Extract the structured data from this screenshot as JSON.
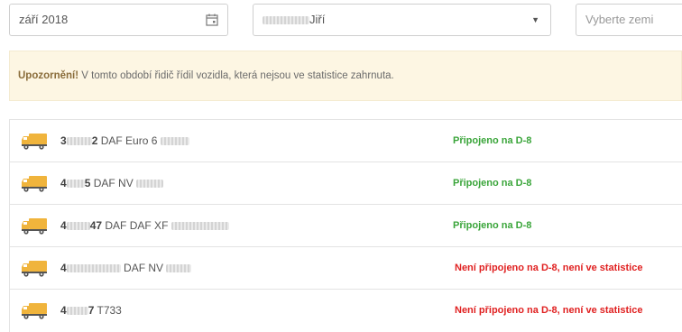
{
  "filters": {
    "month_value": "září 2018",
    "driver_value": "Jiří",
    "country_placeholder": "Vyberte zemi"
  },
  "warning": {
    "title": "Upozornění!",
    "message": "V tomto období řidič řídil vozidla, která nejsou ve statistice zahrnuta."
  },
  "vehicles": [
    {
      "plate_prefix": "3",
      "plate_suffix": "2",
      "model": "DAF Euro 6",
      "status": "Připojeno na D-8",
      "connected": true
    },
    {
      "plate_prefix": "4",
      "plate_suffix": "5",
      "model": "DAF NV",
      "status": "Připojeno na D-8",
      "connected": true
    },
    {
      "plate_prefix": "4",
      "plate_suffix": "47",
      "model": "DAF DAF XF",
      "status": "Připojeno na D-8",
      "connected": true
    },
    {
      "plate_prefix": "4",
      "plate_suffix": "",
      "model": "DAF NV",
      "status": "Není připojeno na D-8, není ve statistice",
      "connected": false
    },
    {
      "plate_prefix": "4",
      "plate_suffix": "7",
      "model": "T733",
      "status": "Není připojeno na D-8, není ve statistice",
      "connected": false
    }
  ],
  "colors": {
    "connected": "#3aa53a",
    "not_connected": "#e02020",
    "warning_bg": "#fdf6e3",
    "truck": "#f0b43c"
  },
  "icons": {
    "calendar": "calendar-icon",
    "dropdown": "caret-down-icon",
    "vehicle": "truck-icon"
  }
}
